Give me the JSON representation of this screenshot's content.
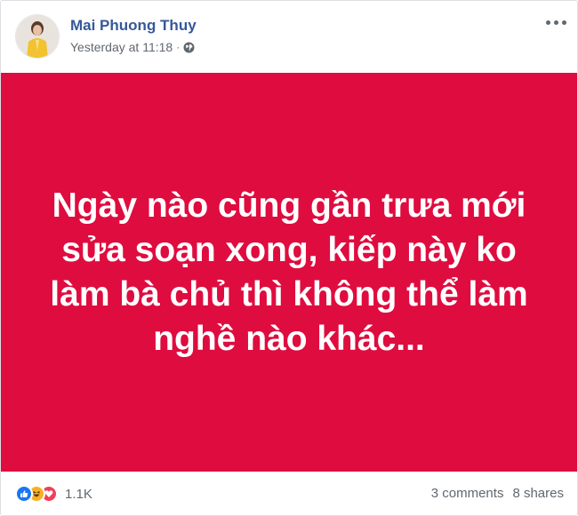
{
  "post": {
    "author": "Mai Phuong Thuy",
    "timestamp": "Yesterday at 11:18",
    "separator": "·",
    "privacy_icon": "globe-icon",
    "body_text": "Ngày nào cũng gần trưa mới sửa soạn xong, kiếp này ko làm bà chủ thì không thể làm nghề nào khác...",
    "background_color": "#df0c3f"
  },
  "footer": {
    "reaction_icons": [
      "like-icon",
      "haha-icon",
      "love-icon"
    ],
    "reaction_count": "1.1K",
    "comments": "3 comments",
    "shares": "8 shares"
  },
  "colors": {
    "author_link": "#365899",
    "meta_text": "#606770",
    "post_background": "#df0c3f"
  }
}
